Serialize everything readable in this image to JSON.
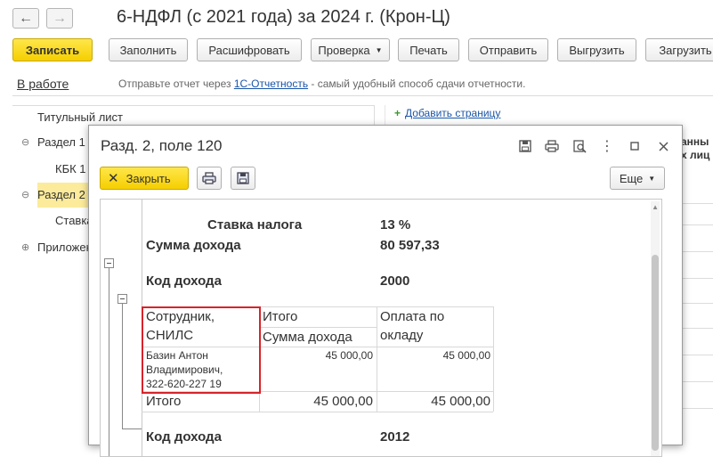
{
  "window": {
    "title": "6-НДФЛ (с 2021 года) за 2024 г. (Крон-Ц)",
    "back_glyph": "←",
    "forward_glyph": "→"
  },
  "toolbar": {
    "save": "Записать",
    "fill": "Заполнить",
    "decode": "Расшифровать",
    "check": "Проверка",
    "print": "Печать",
    "send": "Отправить",
    "unload": "Выгрузить",
    "load": "Загрузить"
  },
  "status": {
    "state": "В работе",
    "hint_before": "Отправьте отчет через ",
    "hint_link": "1С-Отчетность",
    "hint_after": " - самый удобный способ сдачи отчетности."
  },
  "tree": {
    "items": [
      {
        "label": "Титульный лист"
      },
      {
        "label": "Раздел 1",
        "expander": "⊖"
      },
      {
        "label": "КБК 1"
      },
      {
        "label": "Раздел 2",
        "expander": "⊖"
      },
      {
        "label": "Ставка"
      },
      {
        "label": "Приложен",
        "expander": "⊕"
      }
    ]
  },
  "right_panel": {
    "add_page": "Добавить страницу",
    "cut_text_1": "анны",
    "cut_text_2": "х лиц"
  },
  "modal": {
    "title": "Разд. 2, поле 120",
    "close_label": "Закрыть",
    "more_label": "Еще",
    "report": {
      "tax_rate_label": "Ставка налога",
      "tax_rate_value": "13 %",
      "income_sum_label": "Сумма дохода",
      "income_sum_value": "80 597,33",
      "income_code_label": "Код дохода",
      "income_code_value": "2000",
      "table": {
        "col1_header_line1": "Сотрудник,",
        "col1_header_line2": "СНИЛС",
        "col2_header_line1": "Итого",
        "col2_header_line2": "Сумма дохода",
        "col3_header_line1": "Оплата по",
        "col3_header_line2": "окладу",
        "employee_line1": "Базин Антон",
        "employee_line2": "Владимирович,",
        "employee_line3": "322-620-227 19",
        "employee_total": "45 000,00",
        "employee_salary": "45 000,00",
        "total_label": "Итого",
        "total_sum": "45 000,00",
        "total_salary": "45 000,00"
      },
      "next_code_label": "Код дохода",
      "next_code_value": "2012"
    }
  }
}
